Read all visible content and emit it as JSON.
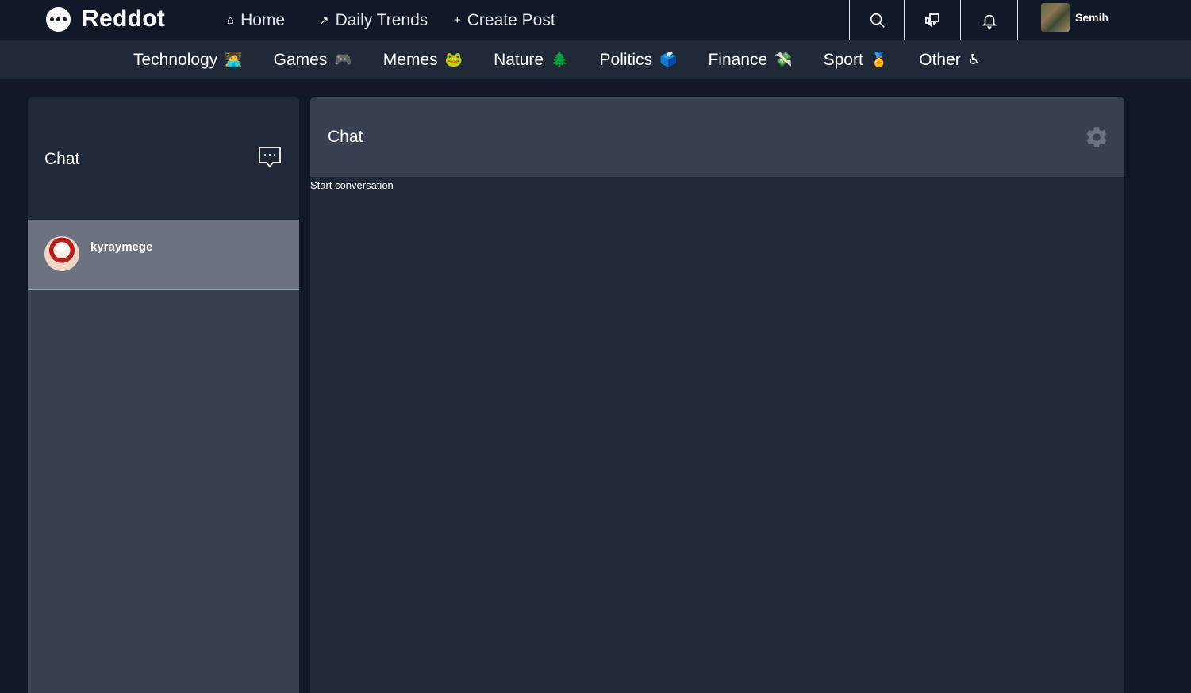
{
  "brand": {
    "name": "Reddot"
  },
  "nav": {
    "home": {
      "icon": "home-icon",
      "glyph": "⌂",
      "label": "Home"
    },
    "trends": {
      "icon": "trending-icon",
      "glyph": "↗",
      "label": "Daily Trends"
    },
    "create": {
      "icon": "plus-icon",
      "glyph": "+",
      "label": "Create Post"
    }
  },
  "toolbar": {
    "icons": [
      "search-icon",
      "messages-icon",
      "bell-icon"
    ]
  },
  "user": {
    "name": "Semih"
  },
  "categories": [
    {
      "label": "Technology",
      "emoji": "🧑‍💻"
    },
    {
      "label": "Games",
      "emoji": "🎮"
    },
    {
      "label": "Memes",
      "emoji": "🐸"
    },
    {
      "label": "Nature",
      "emoji": "🌲"
    },
    {
      "label": "Politics",
      "emoji": "🗳️"
    },
    {
      "label": "Finance",
      "emoji": "💸"
    },
    {
      "label": "Sport",
      "emoji": "🏅"
    },
    {
      "label": "Other",
      "emoji": "♿"
    }
  ],
  "sidebar": {
    "title": "Chat",
    "new_chat_icon": "new-chat-icon",
    "conversations": [
      {
        "name": "kyraymege",
        "active": true
      }
    ]
  },
  "chat": {
    "title": "Chat",
    "settings_icon": "gear-icon",
    "empty_text": "Start conversation"
  },
  "colors": {
    "background": "#111827",
    "header": "#1f2937",
    "panel": "#374151",
    "active_item": "#6b7280",
    "text": "#ffffff"
  }
}
